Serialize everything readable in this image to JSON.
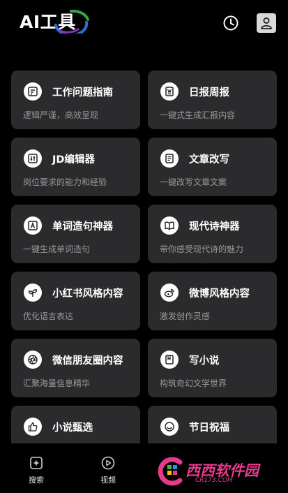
{
  "header": {
    "title": "AI工具"
  },
  "cards": [
    {
      "title": "工作问题指南",
      "desc": "逻辑严谨，高效呈现",
      "icon": "document-text-icon"
    },
    {
      "title": "日报周报",
      "desc": "一键式生成汇报内容",
      "icon": "report-icon"
    },
    {
      "title": "JD编辑器",
      "desc": "岗位要求的能力和经验",
      "icon": "sliders-icon"
    },
    {
      "title": "文章改写",
      "desc": "一键改写文章文案",
      "icon": "article-icon"
    },
    {
      "title": "单词造句神器",
      "desc": "一键生成单词造句",
      "icon": "letter-a-icon"
    },
    {
      "title": "现代诗神器",
      "desc": "带你感受现代诗的魅力",
      "icon": "open-book-icon"
    },
    {
      "title": "小红书风格内容",
      "desc": "优化语言表达",
      "icon": "leaf-icon"
    },
    {
      "title": "微博风格内容",
      "desc": "激发创作灵感",
      "icon": "weibo-icon"
    },
    {
      "title": "微信朋友圈内容",
      "desc": "汇聚海量信息精华",
      "icon": "aperture-icon"
    },
    {
      "title": "写小说",
      "desc": "构筑奇幻文学世界",
      "icon": "bookmark-book-icon"
    },
    {
      "title": "小说甄选",
      "desc": "",
      "icon": "thumbs-up-icon"
    },
    {
      "title": "节日祝福",
      "desc": "",
      "icon": "smiley-icon"
    }
  ],
  "tabs": [
    {
      "label": "搜索",
      "icon": "sparkle-search-icon"
    },
    {
      "label": "视频",
      "icon": "play-circle-icon"
    }
  ],
  "watermark": {
    "text": "西西软件园",
    "sub": "CR173.COM"
  }
}
